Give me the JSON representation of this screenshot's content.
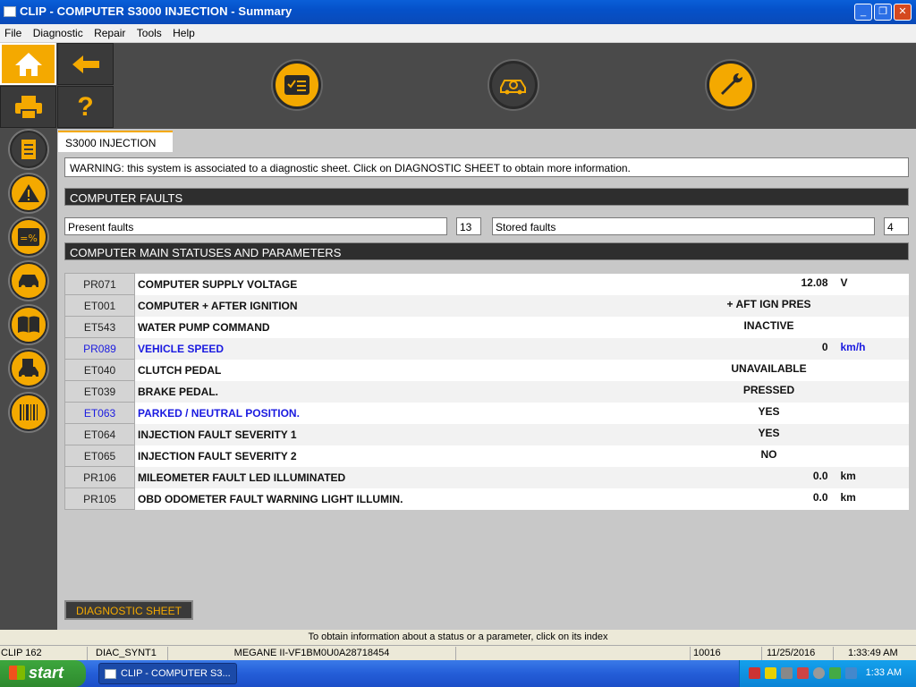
{
  "window": {
    "title": "CLIP - COMPUTER S3000 INJECTION - Summary",
    "min_glyph": "_",
    "max_glyph": "❐",
    "close_glyph": "✕"
  },
  "menu": [
    "File",
    "Diagnostic",
    "Repair",
    "Tools",
    "Help"
  ],
  "toolbar": {
    "left_buttons": [
      {
        "icon": "home-icon",
        "glyph": "⌂"
      },
      {
        "icon": "back-arrow-icon",
        "glyph": "←"
      },
      {
        "icon": "printer-icon",
        "glyph": "▤"
      },
      {
        "icon": "help-icon",
        "glyph": "?"
      }
    ],
    "main_buttons": [
      {
        "icon": "checklist-icon"
      },
      {
        "icon": "vehicle-diagnostic-icon"
      },
      {
        "icon": "wrench-icon"
      }
    ]
  },
  "sidebar": {
    "items": [
      {
        "icon": "document-icon"
      },
      {
        "icon": "warning-icon"
      },
      {
        "icon": "parameters-percent-icon"
      },
      {
        "icon": "vehicle-icon"
      },
      {
        "icon": "manual-book-icon"
      },
      {
        "icon": "vehicle-save-icon"
      },
      {
        "icon": "barcode-icon"
      }
    ]
  },
  "tab": {
    "label": "S3000 INJECTION"
  },
  "warning": "WARNING: this system is associated to a diagnostic sheet. Click on DIAGNOSTIC SHEET to obtain more information.",
  "faults": {
    "header": "COMPUTER FAULTS",
    "present_label": "Present faults",
    "present_count": "13",
    "stored_label": "Stored faults",
    "stored_count": "4"
  },
  "params": {
    "header": "COMPUTER MAIN STATUSES AND PARAMETERS",
    "rows": [
      {
        "index": "PR071",
        "name": "COMPUTER SUPPLY VOLTAGE",
        "value": "12.08",
        "unit": "V",
        "link": false
      },
      {
        "index": "ET001",
        "name": "COMPUTER + AFTER IGNITION",
        "value": "+ AFT IGN PRES",
        "unit": "",
        "link": false
      },
      {
        "index": "ET543",
        "name": "WATER PUMP COMMAND",
        "value": "INACTIVE",
        "unit": "",
        "link": false
      },
      {
        "index": "PR089",
        "name": "VEHICLE SPEED",
        "value": "0",
        "unit": "km/h",
        "link": true
      },
      {
        "index": "ET040",
        "name": "CLUTCH PEDAL",
        "value": "UNAVAILABLE",
        "unit": "",
        "link": false
      },
      {
        "index": "ET039",
        "name": "BRAKE PEDAL.",
        "value": "PRESSED",
        "unit": "",
        "link": false
      },
      {
        "index": "ET063",
        "name": "PARKED / NEUTRAL POSITION.",
        "value": "YES",
        "unit": "",
        "link": true
      },
      {
        "index": "ET064",
        "name": "INJECTION FAULT SEVERITY 1",
        "value": "YES",
        "unit": "",
        "link": false
      },
      {
        "index": "ET065",
        "name": "INJECTION FAULT SEVERITY 2",
        "value": "NO",
        "unit": "",
        "link": false
      },
      {
        "index": "PR106",
        "name": "MILEOMETER FAULT LED ILLUMINATED",
        "value": "0.0",
        "unit": "km",
        "link": false
      },
      {
        "index": "PR105",
        "name": "OBD ODOMETER FAULT WARNING LIGHT ILLUMIN.",
        "value": "0.0",
        "unit": "km",
        "link": false
      }
    ]
  },
  "diag_sheet_button": "DIAGNOSTIC SHEET",
  "hint": "To obtain information about a status or a parameter, click on its index",
  "statusbar": {
    "clip": "CLIP 162",
    "diac": "DIAC_SYNT1",
    "vehicle": "MEGANE II-VF1BM0U0A28718454",
    "code": "10016",
    "date": "11/25/2016",
    "time": "1:33:49 AM"
  },
  "taskbar": {
    "start": "start",
    "task": "CLIP - COMPUTER S3...",
    "clock": "1:33 AM"
  },
  "colors": {
    "accent": "#f4a900",
    "toolbar_bg": "#4a4a4a",
    "link_blue": "#1a1ae0",
    "section_header": "#2e2e2e"
  }
}
